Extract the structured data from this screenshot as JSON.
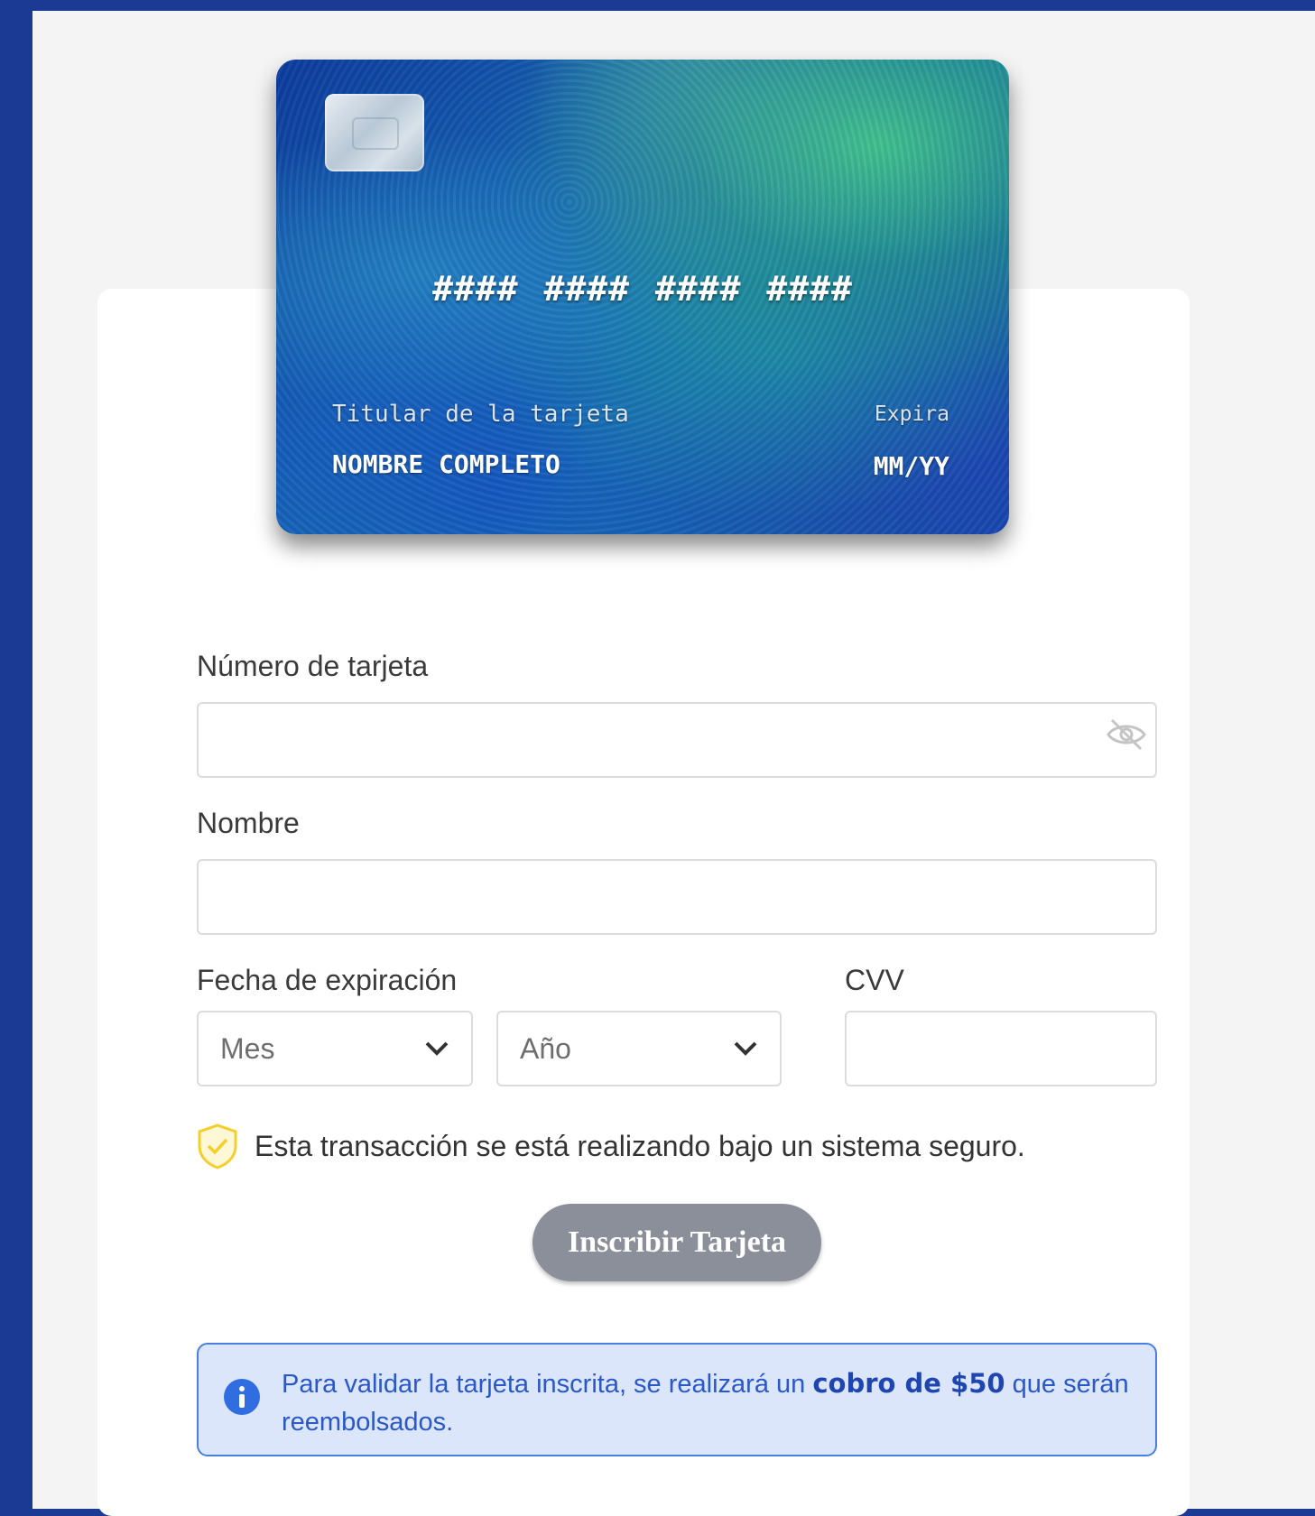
{
  "card_preview": {
    "number_mask": "#### #### #### ####",
    "holder_label": "Titular de la tarjeta",
    "holder_value": "NOMBRE COMPLETO",
    "expires_label": "Expira",
    "expires_value": "MM/YY"
  },
  "form": {
    "card_number_label": "Número de tarjeta",
    "card_number_value": "",
    "name_label": "Nombre",
    "name_value": "",
    "expiration_label": "Fecha de expiración",
    "month_placeholder": "Mes",
    "year_placeholder": "Año",
    "cvv_label": "CVV",
    "cvv_value": ""
  },
  "secure_notice": "Esta transacción se está realizando bajo un sistema seguro.",
  "submit_label": "Inscribir Tarjeta",
  "info": {
    "text_before": "Para validar la tarjeta inscrita, se realizará un ",
    "text_bold": "cobro de $50",
    "text_after": " que serán reembolsados."
  },
  "colors": {
    "frame": "#1b3a94",
    "button": "#8b8f99",
    "info_border": "#4a7fe0",
    "info_bg": "#dbe6fb",
    "shield": "#f2cf2a"
  }
}
